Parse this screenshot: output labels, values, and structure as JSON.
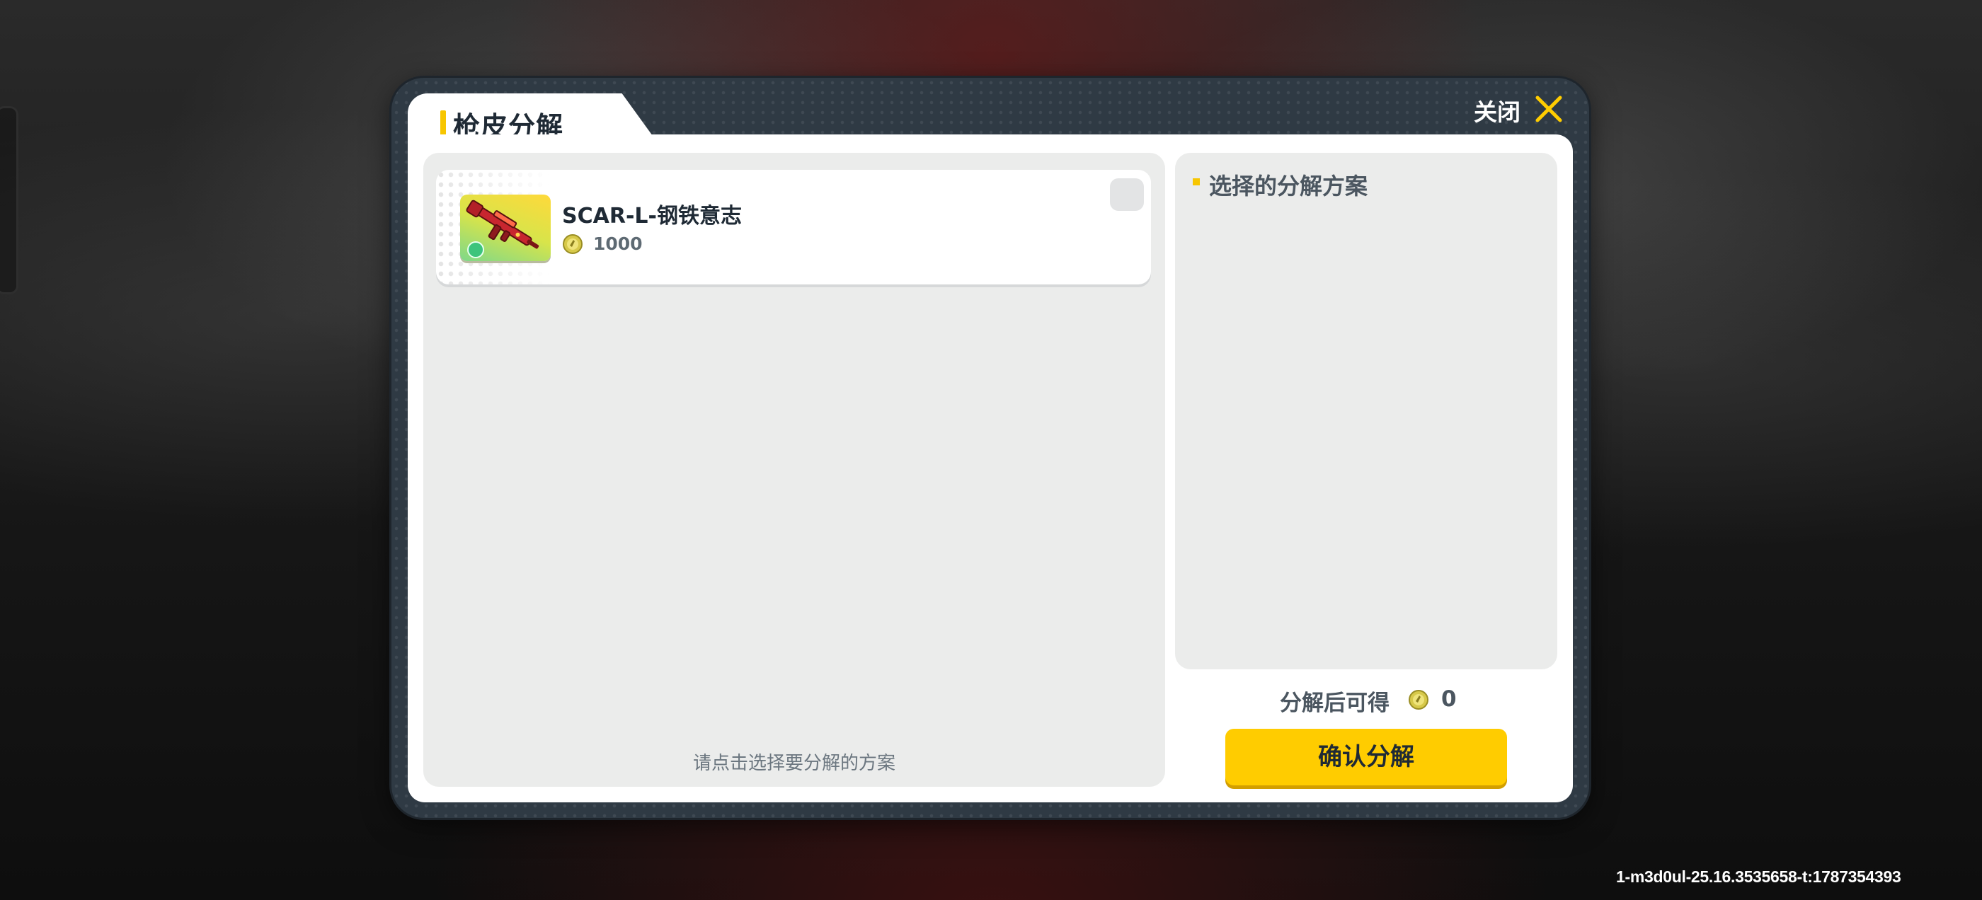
{
  "dialog": {
    "title": "枪皮分解",
    "close_label": "关闭"
  },
  "item_list": {
    "items": [
      {
        "name": "SCAR-L-钢铁意志",
        "price": "1000",
        "currency_icon": "coin-icon",
        "thumbnail_icon": "rifle-icon",
        "selected": false
      }
    ],
    "hint": "请点击选择要分解的方案"
  },
  "plan_panel": {
    "title": "选择的分解方案",
    "yield_label": "分解后可得",
    "yield_value": "0",
    "confirm_label": "确认分解"
  },
  "build_id": "1-m3d0ul-25.16.3535658-t:1787354393",
  "colors": {
    "accent": "#ffcc00",
    "frame": "#2f3a44",
    "panel": "#ebeceb",
    "title_text": "#1f2a35"
  }
}
